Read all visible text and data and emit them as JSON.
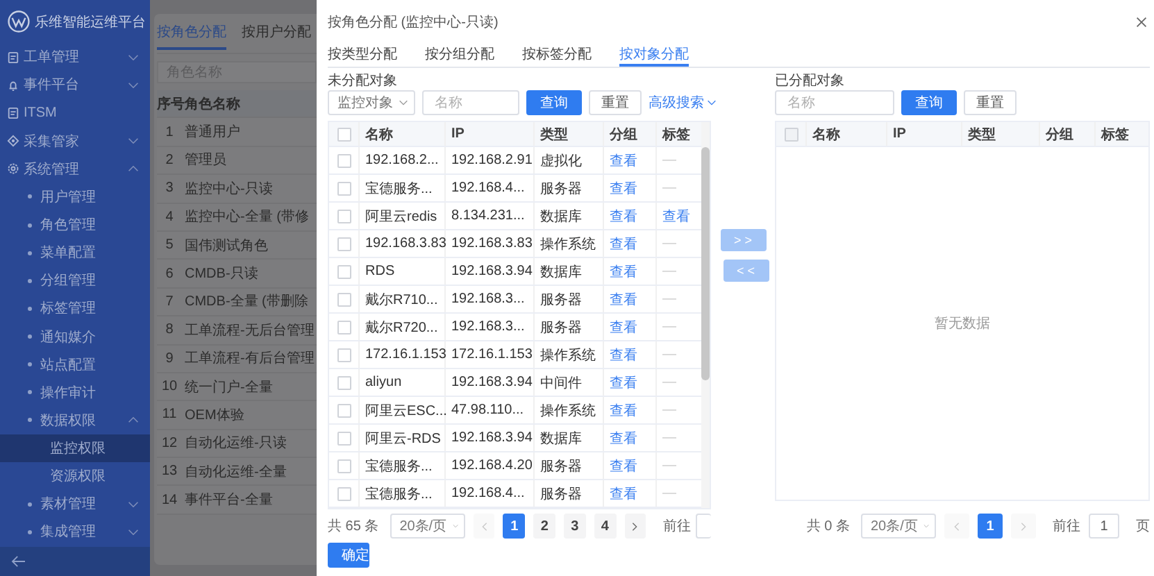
{
  "sidebar": {
    "logo_text": "乐维智能运维平台",
    "items": [
      {
        "label": "工单管理",
        "expanded": false,
        "selected": false
      },
      {
        "label": "事件平台",
        "expanded": false,
        "selected": false
      },
      {
        "label": "ITSM",
        "selected": false
      },
      {
        "label": "采集管家",
        "expanded": false,
        "selected": false
      },
      {
        "label": "系统管理",
        "expanded": true,
        "selected": false,
        "children": [
          {
            "label": "用户管理",
            "selected": false
          },
          {
            "label": "角色管理",
            "selected": false
          },
          {
            "label": "菜单配置",
            "selected": false
          },
          {
            "label": "分组管理",
            "selected": false
          },
          {
            "label": "标签管理",
            "selected": false
          },
          {
            "label": "通知媒介",
            "selected": false
          },
          {
            "label": "站点配置",
            "selected": false
          },
          {
            "label": "操作审计",
            "selected": false
          },
          {
            "label": "数据权限",
            "expanded": true,
            "selected": false,
            "children": [
              {
                "label": "监控权限",
                "selected": true
              },
              {
                "label": "资源权限",
                "selected": false
              }
            ]
          },
          {
            "label": "素材管理",
            "expanded": false,
            "selected": false
          },
          {
            "label": "集成管理",
            "expanded": false,
            "selected": false
          }
        ]
      }
    ]
  },
  "page": {
    "tabs": [
      {
        "label": "按角色分配",
        "selected": true
      },
      {
        "label": "按用户分配",
        "selected": false
      }
    ],
    "search": {
      "placeholder": "角色名称"
    },
    "table": {
      "columns": [
        "序号",
        "角色名称"
      ],
      "rows": [
        [
          "1",
          "普通用户"
        ],
        [
          "2",
          "管理员"
        ],
        [
          "3",
          "监控中心-只读"
        ],
        [
          "4",
          "监控中心-全量 (带修"
        ],
        [
          "5",
          "国伟测试角色"
        ],
        [
          "6",
          "CMDB-只读"
        ],
        [
          "7",
          "CMDB-全量 (带删除"
        ],
        [
          "8",
          "工单流程-无后台管理"
        ],
        [
          "9",
          "工单流程-有后台管理"
        ],
        [
          "10",
          "统一门户-全量"
        ],
        [
          "11",
          "OEM体验"
        ],
        [
          "12",
          "自动化运维-只读"
        ],
        [
          "13",
          "自动化运维-全量"
        ],
        [
          "14",
          "事件平台-全量"
        ]
      ]
    }
  },
  "drawer": {
    "title": "按角色分配 (监控中心-只读)",
    "tabs": [
      {
        "label": "按类型分配",
        "selected": false
      },
      {
        "label": "按分组分配",
        "selected": false
      },
      {
        "label": "按标签分配",
        "selected": false
      },
      {
        "label": "按对象分配",
        "selected": true
      }
    ],
    "unassigned": {
      "label": "未分配对象",
      "type_select": "监控对象",
      "search": {
        "placeholder": "名称"
      },
      "query_button": "查询",
      "reset_button": "重置",
      "advanced_search": "高级搜索",
      "table": {
        "columns": [
          "名称",
          "IP",
          "类型",
          "分组",
          "标签"
        ],
        "header_checked": false,
        "rows": [
          {
            "checked": false,
            "name": "192.168.2...",
            "ip": "192.168.2.91",
            "type": "虚拟化",
            "group": "查看",
            "tag": {
              "text": "—",
              "link": false
            }
          },
          {
            "checked": false,
            "name": "宝德服务...",
            "ip": "192.168.4...",
            "type": "服务器",
            "group": "查看",
            "tag": {
              "text": "—",
              "link": false
            }
          },
          {
            "checked": false,
            "name": "阿里云redis",
            "ip": "8.134.231...",
            "type": "数据库",
            "group": "查看",
            "tag": {
              "text": "查看",
              "link": true
            }
          },
          {
            "checked": false,
            "name": "192.168.3.83",
            "ip": "192.168.3.83",
            "type": "操作系统",
            "group": "查看",
            "tag": {
              "text": "—",
              "link": false
            }
          },
          {
            "checked": false,
            "name": "RDS",
            "ip": "192.168.3.94",
            "type": "数据库",
            "group": "查看",
            "tag": {
              "text": "—",
              "link": false
            }
          },
          {
            "checked": false,
            "name": "戴尔R710...",
            "ip": "192.168.3...",
            "type": "服务器",
            "group": "查看",
            "tag": {
              "text": "—",
              "link": false
            }
          },
          {
            "checked": false,
            "name": "戴尔R720...",
            "ip": "192.168.3...",
            "type": "服务器",
            "group": "查看",
            "tag": {
              "text": "—",
              "link": false
            }
          },
          {
            "checked": false,
            "name": "172.16.1.153",
            "ip": "172.16.1.153",
            "type": "操作系统",
            "group": "查看",
            "tag": {
              "text": "—",
              "link": false
            }
          },
          {
            "checked": false,
            "name": "aliyun",
            "ip": "192.168.3.94",
            "type": "中间件",
            "group": "查看",
            "tag": {
              "text": "—",
              "link": false
            }
          },
          {
            "checked": false,
            "name": "阿里云ESC...",
            "ip": "47.98.110...",
            "type": "操作系统",
            "group": "查看",
            "tag": {
              "text": "—",
              "link": false
            }
          },
          {
            "checked": false,
            "name": "阿里云-RDS",
            "ip": "192.168.3.94",
            "type": "数据库",
            "group": "查看",
            "tag": {
              "text": "—",
              "link": false
            }
          },
          {
            "checked": false,
            "name": "宝德服务...",
            "ip": "192.168.4.20",
            "type": "服务器",
            "group": "查看",
            "tag": {
              "text": "—",
              "link": false
            }
          },
          {
            "checked": false,
            "name": "宝德服务...",
            "ip": "192.168.4...",
            "type": "服务器",
            "group": "查看",
            "tag": {
              "text": "—",
              "link": false
            }
          }
        ]
      },
      "pagination": {
        "total": "共 65 条",
        "page_size": "20条/页",
        "prev_disabled": true,
        "next_disabled": false,
        "pages": [
          {
            "label": "1",
            "selected": true
          },
          {
            "label": "2",
            "selected": false
          },
          {
            "label": "3",
            "selected": false
          },
          {
            "label": "4",
            "selected": false
          }
        ],
        "goto": "前往"
      }
    },
    "transfer": [
      {
        "label": "> >",
        "disabled": true
      },
      {
        "label": "< <",
        "disabled": true
      }
    ],
    "assigned": {
      "label": "已分配对象",
      "search": {
        "placeholder": "名称"
      },
      "query_button": "查询",
      "reset_button": "重置",
      "table": {
        "columns": [
          "名称",
          "IP",
          "类型",
          "分组",
          "标签"
        ],
        "header_checked": false,
        "header_disabled": true,
        "empty": "暂无数据"
      },
      "pagination": {
        "total": "共 0 条",
        "page_size": "20条/页",
        "prev_disabled": true,
        "next_disabled": true,
        "pages": [
          {
            "label": "1",
            "selected": true
          }
        ],
        "goto": "前往",
        "goto_value": "1",
        "unit": "页"
      }
    },
    "confirm_button": "确定"
  }
}
